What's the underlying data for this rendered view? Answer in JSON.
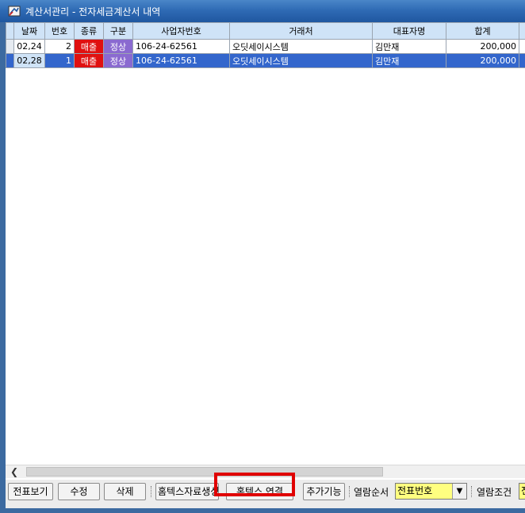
{
  "window": {
    "title": "계산서관리 - 전자세금계산서 내역"
  },
  "grid": {
    "columns": [
      "날짜",
      "번호",
      "종류",
      "구분",
      "사업자번호",
      "거래처",
      "대표자명",
      "합계"
    ],
    "rows": [
      {
        "date": "02,24",
        "no": "2",
        "kind": "매출",
        "type": "정상",
        "biz_no": "106-24-62561",
        "vendor": "오딧세이시스템",
        "rep": "김만재",
        "total": "200,000",
        "selected": false
      },
      {
        "date": "02,28",
        "no": "1",
        "kind": "매출",
        "type": "정상",
        "biz_no": "106-24-62561",
        "vendor": "오딧세이시스템",
        "rep": "김만재",
        "total": "200,000",
        "selected": true
      }
    ]
  },
  "toolbar": {
    "view_label": "전표보기",
    "edit_label": "수정",
    "delete_label": "삭제",
    "hometax_generate_label": "홈텍스자료생성",
    "hometax_connect_label": "홈텍스 연결",
    "more_label": "추가기능",
    "sort_label": "열람순서",
    "sort_value": "전표번호",
    "filter_label": "열람조건",
    "filter_value": "전"
  },
  "colors": {
    "title_bar": "#2f6bb5",
    "selection": "#3366cc",
    "sales_badge": "#e01010",
    "normal_badge": "#8a6ad0",
    "highlight_box": "#e00000"
  }
}
